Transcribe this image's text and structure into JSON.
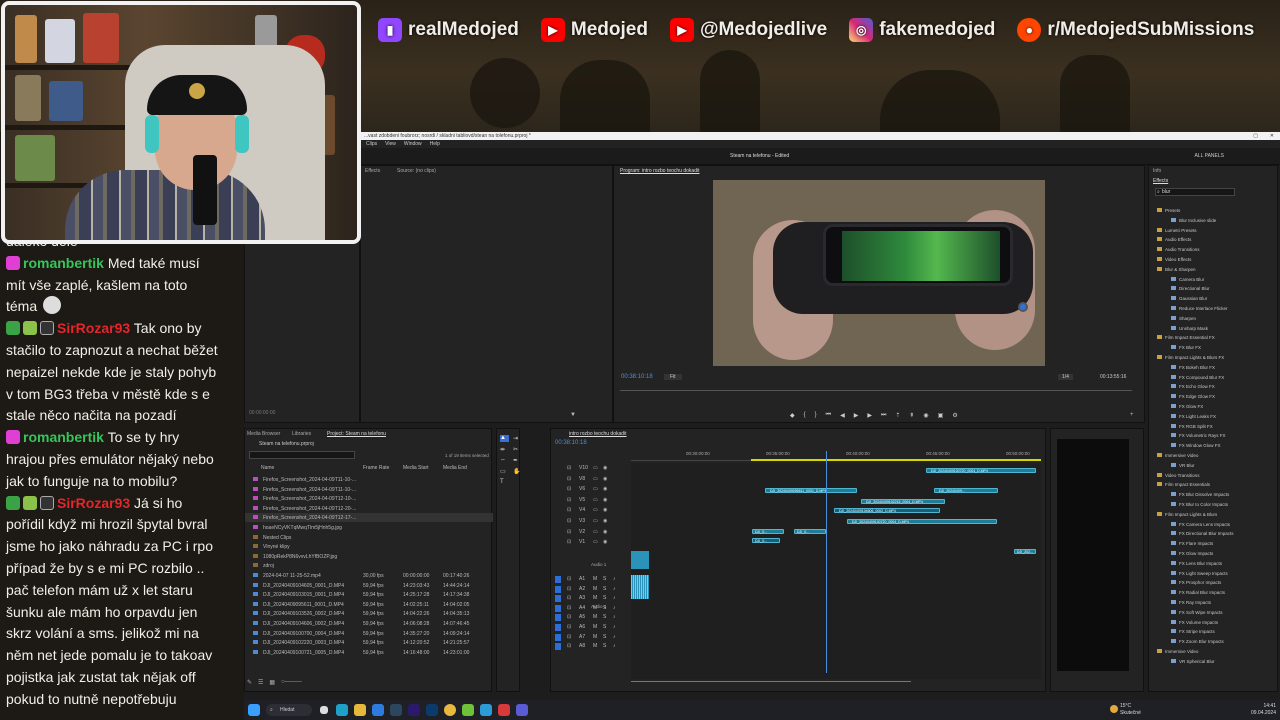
{
  "overlay": {
    "socials": [
      {
        "icon": "twitch-icon",
        "label": "realMedojed",
        "color": "#9146ff"
      },
      {
        "icon": "youtube-icon",
        "label": "Medojed",
        "color": "#ff0000"
      },
      {
        "icon": "youtube-icon",
        "label": "@Medojedlive",
        "color": "#ff0000"
      },
      {
        "icon": "instagram-icon",
        "label": "fakemedojed",
        "color": "#d62976"
      },
      {
        "icon": "reddit-icon",
        "label": "r/MedojedSubMissions",
        "color": "#ff4500"
      }
    ]
  },
  "chat": {
    "partial_top": "daleko dele",
    "messages": [
      {
        "badges": [
          "prime"
        ],
        "user": "romanbertik",
        "user_color": "#37c45b",
        "lines": [
          "Med také musí",
          "mít vše zaplé, kašlem na toto",
          "téma"
        ],
        "emote": true
      },
      {
        "badges": [
          "check",
          "sub",
          "gift"
        ],
        "user": "SirRozar93",
        "user_color": "#e3262c",
        "lines": [
          "Tak ono by",
          "stačilo to zapnozut a nechat běžet",
          "nepaizel nekde kde je staly pohyb",
          "v tom BG3 třeba v městě kde s e",
          "stale něco načita na pozadí"
        ]
      },
      {
        "badges": [
          "prime"
        ],
        "user": "romanbertik",
        "user_color": "#37c45b",
        "lines": [
          "To se ty hry",
          "hrajou přes emulátor nějaký nebo",
          "jak to funguje na to mobilu?"
        ]
      },
      {
        "badges": [
          "check",
          "sub",
          "gift"
        ],
        "user": "SirRozar93",
        "user_color": "#e3262c",
        "lines": [
          "Já si ho",
          "pořídil když mi hrozil špytal bvral",
          "jsme ho jako náhradu za PC i rpo",
          "případ že by s e mi PC rozbilo ..",
          "pač telefon mám už x let staru",
          "šunku ale mám ho orpavdu jen",
          "skrz volání a sms. jelikož mi na",
          "něm net jede pomalu je to takoav",
          "pojistka jak zustat tak nějak off",
          "pokud to nutně nepotřebuju"
        ]
      }
    ]
  },
  "premiere": {
    "title": "...vast zdobdeni foubrorz; nosrdi / skladni tabliovd/stean na tolefonu.prproj *",
    "menu": [
      "Clips",
      "View",
      "Window",
      "Help"
    ],
    "sequence_title": "Steam na telefonu - Edited",
    "workspace_label": "ALL PANELS",
    "source_tabs": [
      "Effects",
      "Source: (no clips)"
    ],
    "program_tab": "Program: intro rozbo teochu dokadit",
    "program_timecode_left": "00:38:10:18",
    "program_fit": "Fit",
    "program_quality": "1/4",
    "program_timecode_right": "00:13:55:16",
    "source_timecode": "00:00:00:00",
    "project_tabs": [
      "Media Browser",
      "Libraries",
      "Project: Steam na telefonu"
    ],
    "project_file": "Steam na telefonu.prproj",
    "project_selected": "1 of 19 items selected",
    "project_columns": [
      "Name",
      "Frame Rate",
      "Media Start",
      "Media End"
    ],
    "project_items": [
      {
        "name": "Firefox_Screenshot_2024-04-09T11-10-...",
        "rate": "",
        "start": "",
        "end": ""
      },
      {
        "name": "Firefox_Screenshot_2024-04-09T11-10-...",
        "rate": "",
        "start": "",
        "end": ""
      },
      {
        "name": "Firefox_Screenshot_2024-04-09T12-10-...",
        "rate": "",
        "start": "",
        "end": ""
      },
      {
        "name": "Firefox_Screenshot_2024-04-09T12-20-...",
        "rate": "",
        "start": "",
        "end": ""
      },
      {
        "name": "Firefox_Screenshot_2024-04-09T12-17-...",
        "rate": "",
        "start": "",
        "end": ""
      },
      {
        "name": "hoaeNCyVKTqMwqTlm5jHnh5g.jpg",
        "rate": "",
        "start": "",
        "end": ""
      },
      {
        "name": "Nested Clips",
        "rate": "",
        "start": "",
        "end": ""
      },
      {
        "name": "Vlnyné klipy",
        "rate": "",
        "start": "",
        "end": ""
      },
      {
        "name": "1080pRekP8N6vvvLhYfBOZP.jpg",
        "rate": "",
        "start": "",
        "end": ""
      },
      {
        "name": "zdroj",
        "rate": "",
        "start": "",
        "end": ""
      },
      {
        "name": "2024-04-07 11-25-52.mp4",
        "rate": "30,00 fps",
        "start": "00:00:00:00",
        "end": "00:17:40:26"
      },
      {
        "name": "DJI_20240409104605_0001_D.MP4",
        "rate": "59,94 fps",
        "start": "14:23:03:43",
        "end": "14:44:24:14"
      },
      {
        "name": "DJI_20240409103015_0001_D.MP4",
        "rate": "59,94 fps",
        "start": "14:25:17:28",
        "end": "14:17:34:38"
      },
      {
        "name": "DJI_20240409095611_0001_D.MP4",
        "rate": "59,94 fps",
        "start": "14:02:25:11",
        "end": "14:04:02:05"
      },
      {
        "name": "DJI_20240409103526_0002_D.MP4",
        "rate": "59,94 fps",
        "start": "14:04:22:26",
        "end": "14:04:35:13"
      },
      {
        "name": "DJI_20240409104606_0002_D.MP4",
        "rate": "59,94 fps",
        "start": "14:06:08:28",
        "end": "14:07:46:45"
      },
      {
        "name": "DJI_20240409100700_0004_D.MP4",
        "rate": "59,94 fps",
        "start": "14:35:27:20",
        "end": "14:09:24:14"
      },
      {
        "name": "DJI_20240409102220_0003_D.MP4",
        "rate": "59,94 fps",
        "start": "14:12:20:52",
        "end": "14:21:25:57"
      },
      {
        "name": "DJI_20240409100721_0005_D.MP4",
        "rate": "59,94 fps",
        "start": "14:16:48:00",
        "end": "14:23:01:00"
      }
    ],
    "timeline_tab": "intro rozbo teochu dokadit",
    "timeline_timecode": "00:38:10:18",
    "ruler": [
      "00:30:00:00",
      "00:35:00:00",
      "00:40:00:00",
      "00:45:00:00",
      "00:50:00:00"
    ],
    "video_tracks": [
      "V10",
      "V8",
      "V6",
      "V5",
      "V4",
      "V3",
      "V2",
      "V1"
    ],
    "audio_tracks": [
      "A1",
      "A2",
      "A3",
      "A4",
      "A5",
      "A6",
      "A7",
      "A8"
    ],
    "audio_track_labels": [
      "Audio 1",
      "Audio 2"
    ],
    "clips": [
      {
        "label": "DJI_20240409100720_0004_D.MP4",
        "track": "V10"
      },
      {
        "label": "DJI_20240409095611_0001_D.MP4",
        "track": "V6"
      },
      {
        "label": "DJI_20240409...",
        "track": "V6"
      },
      {
        "label": "DJI_20240409104606_0002_D.MP4",
        "track": "V5"
      },
      {
        "label": "DJI_20240409102215_0004_D.MP4",
        "track": "V4"
      },
      {
        "label": "DJI_20240409100720_0004_D.MP4",
        "track": "V3"
      },
      {
        "label": "DJI_0...",
        "track": "V2"
      },
      {
        "label": "DJI_0...",
        "track": "V2"
      },
      {
        "label": "DJI_0...",
        "track": "V1"
      },
      {
        "label": "DJI_202...",
        "track": "V1"
      }
    ],
    "info_tab": "Info",
    "effects_tab": "Effects",
    "effects_search": "blur",
    "effects_tree": [
      "Presets",
      "Blur Inclusive slide",
      "Lumetri Presets",
      "Audio Effects",
      "Audio Transitions",
      "Video Effects",
      "Blur & Sharpen",
      "Camera Blur",
      "Directional Blur",
      "Gaussian Blur",
      "Reduce Interlace Flicker",
      "Sharpen",
      "Unsharp Mask",
      "Film Impact Essential FX",
      "FX Blur FX",
      "Film Impact Lights & Blurs FX",
      "FX Bokeh Blur FX",
      "FX Compound Blur FX",
      "FX Echo Glow FX",
      "FX Edge Glow FX",
      "FX Glow FX",
      "FX Light Leaks FX",
      "FX RGB Split FX",
      "FX Volumetric Rays FX",
      "FX Window Glow FX",
      "Immersive Video",
      "VR Blur",
      "Video Transitions",
      "Film Impact Essentials",
      "FX Blur Dissolve Impacts",
      "FX Blur to Color Impacts",
      "Film Impact Lights & Blurs",
      "FX Camera Lens Impacts",
      "FX Directional Blur Impacts",
      "FX Flare Impacts",
      "FX Glow Impacts",
      "FX Lens Blur Impacts",
      "FX Light Sweep Impacts",
      "FX Prosphor Impacts",
      "FX Radial Blur Impacts",
      "FX Ray Impacts",
      "FX Soft Wipe Impacts",
      "FX Volume Impacts",
      "FX Stripe Impacts",
      "FX Zoom Blur Impacts",
      "Immersive Video",
      "VR Spherical Blur"
    ]
  },
  "taskbar": {
    "search_label": "Hledat",
    "weather_temp": "15°C",
    "weather_text": "Skutečné",
    "time": "14:41",
    "date": "09.04.2024"
  }
}
